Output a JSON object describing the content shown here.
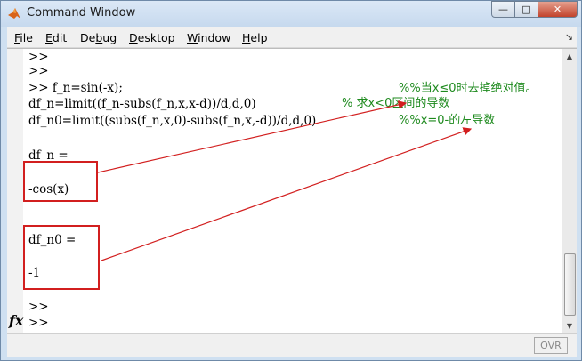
{
  "window": {
    "title": "Command Window",
    "controls": {
      "minimize": "—",
      "maximize": "□",
      "close": "✕"
    }
  },
  "menu": {
    "items": [
      {
        "accel": "F",
        "rest": "ile"
      },
      {
        "accel": "E",
        "rest": "dit"
      },
      {
        "pre": "De",
        "accel": "b",
        "rest": "ug"
      },
      {
        "accel": "D",
        "rest": "esktop"
      },
      {
        "accel": "W",
        "rest": "indow"
      },
      {
        "accel": "H",
        "rest": "elp"
      }
    ],
    "dock_icon": "↘"
  },
  "console": {
    "lines": [
      ">>",
      ">>",
      ">> f_n=sin(-x);",
      "df_n=limit((f_n-subs(f_n,x,x-d))/d,d,0)",
      "df_n0=limit((subs(f_n,x,0)-subs(f_n,x,-d))/d,d,0)",
      "",
      "df_n =",
      "",
      "-cos(x)",
      "",
      "",
      "df_n0 =",
      "",
      "-1",
      "",
      ">>",
      ">>"
    ],
    "inline_comment": "% 求x<0区间的导数"
  },
  "annotations": {
    "note1": "%%当x≤0时去掉绝对值。",
    "note2": "%%x=0-的左导数"
  },
  "prompt_icon": "fx",
  "status": {
    "ovr": "OVR"
  },
  "colors": {
    "comment": "#1e8a1e",
    "box": "#d21f1f"
  }
}
